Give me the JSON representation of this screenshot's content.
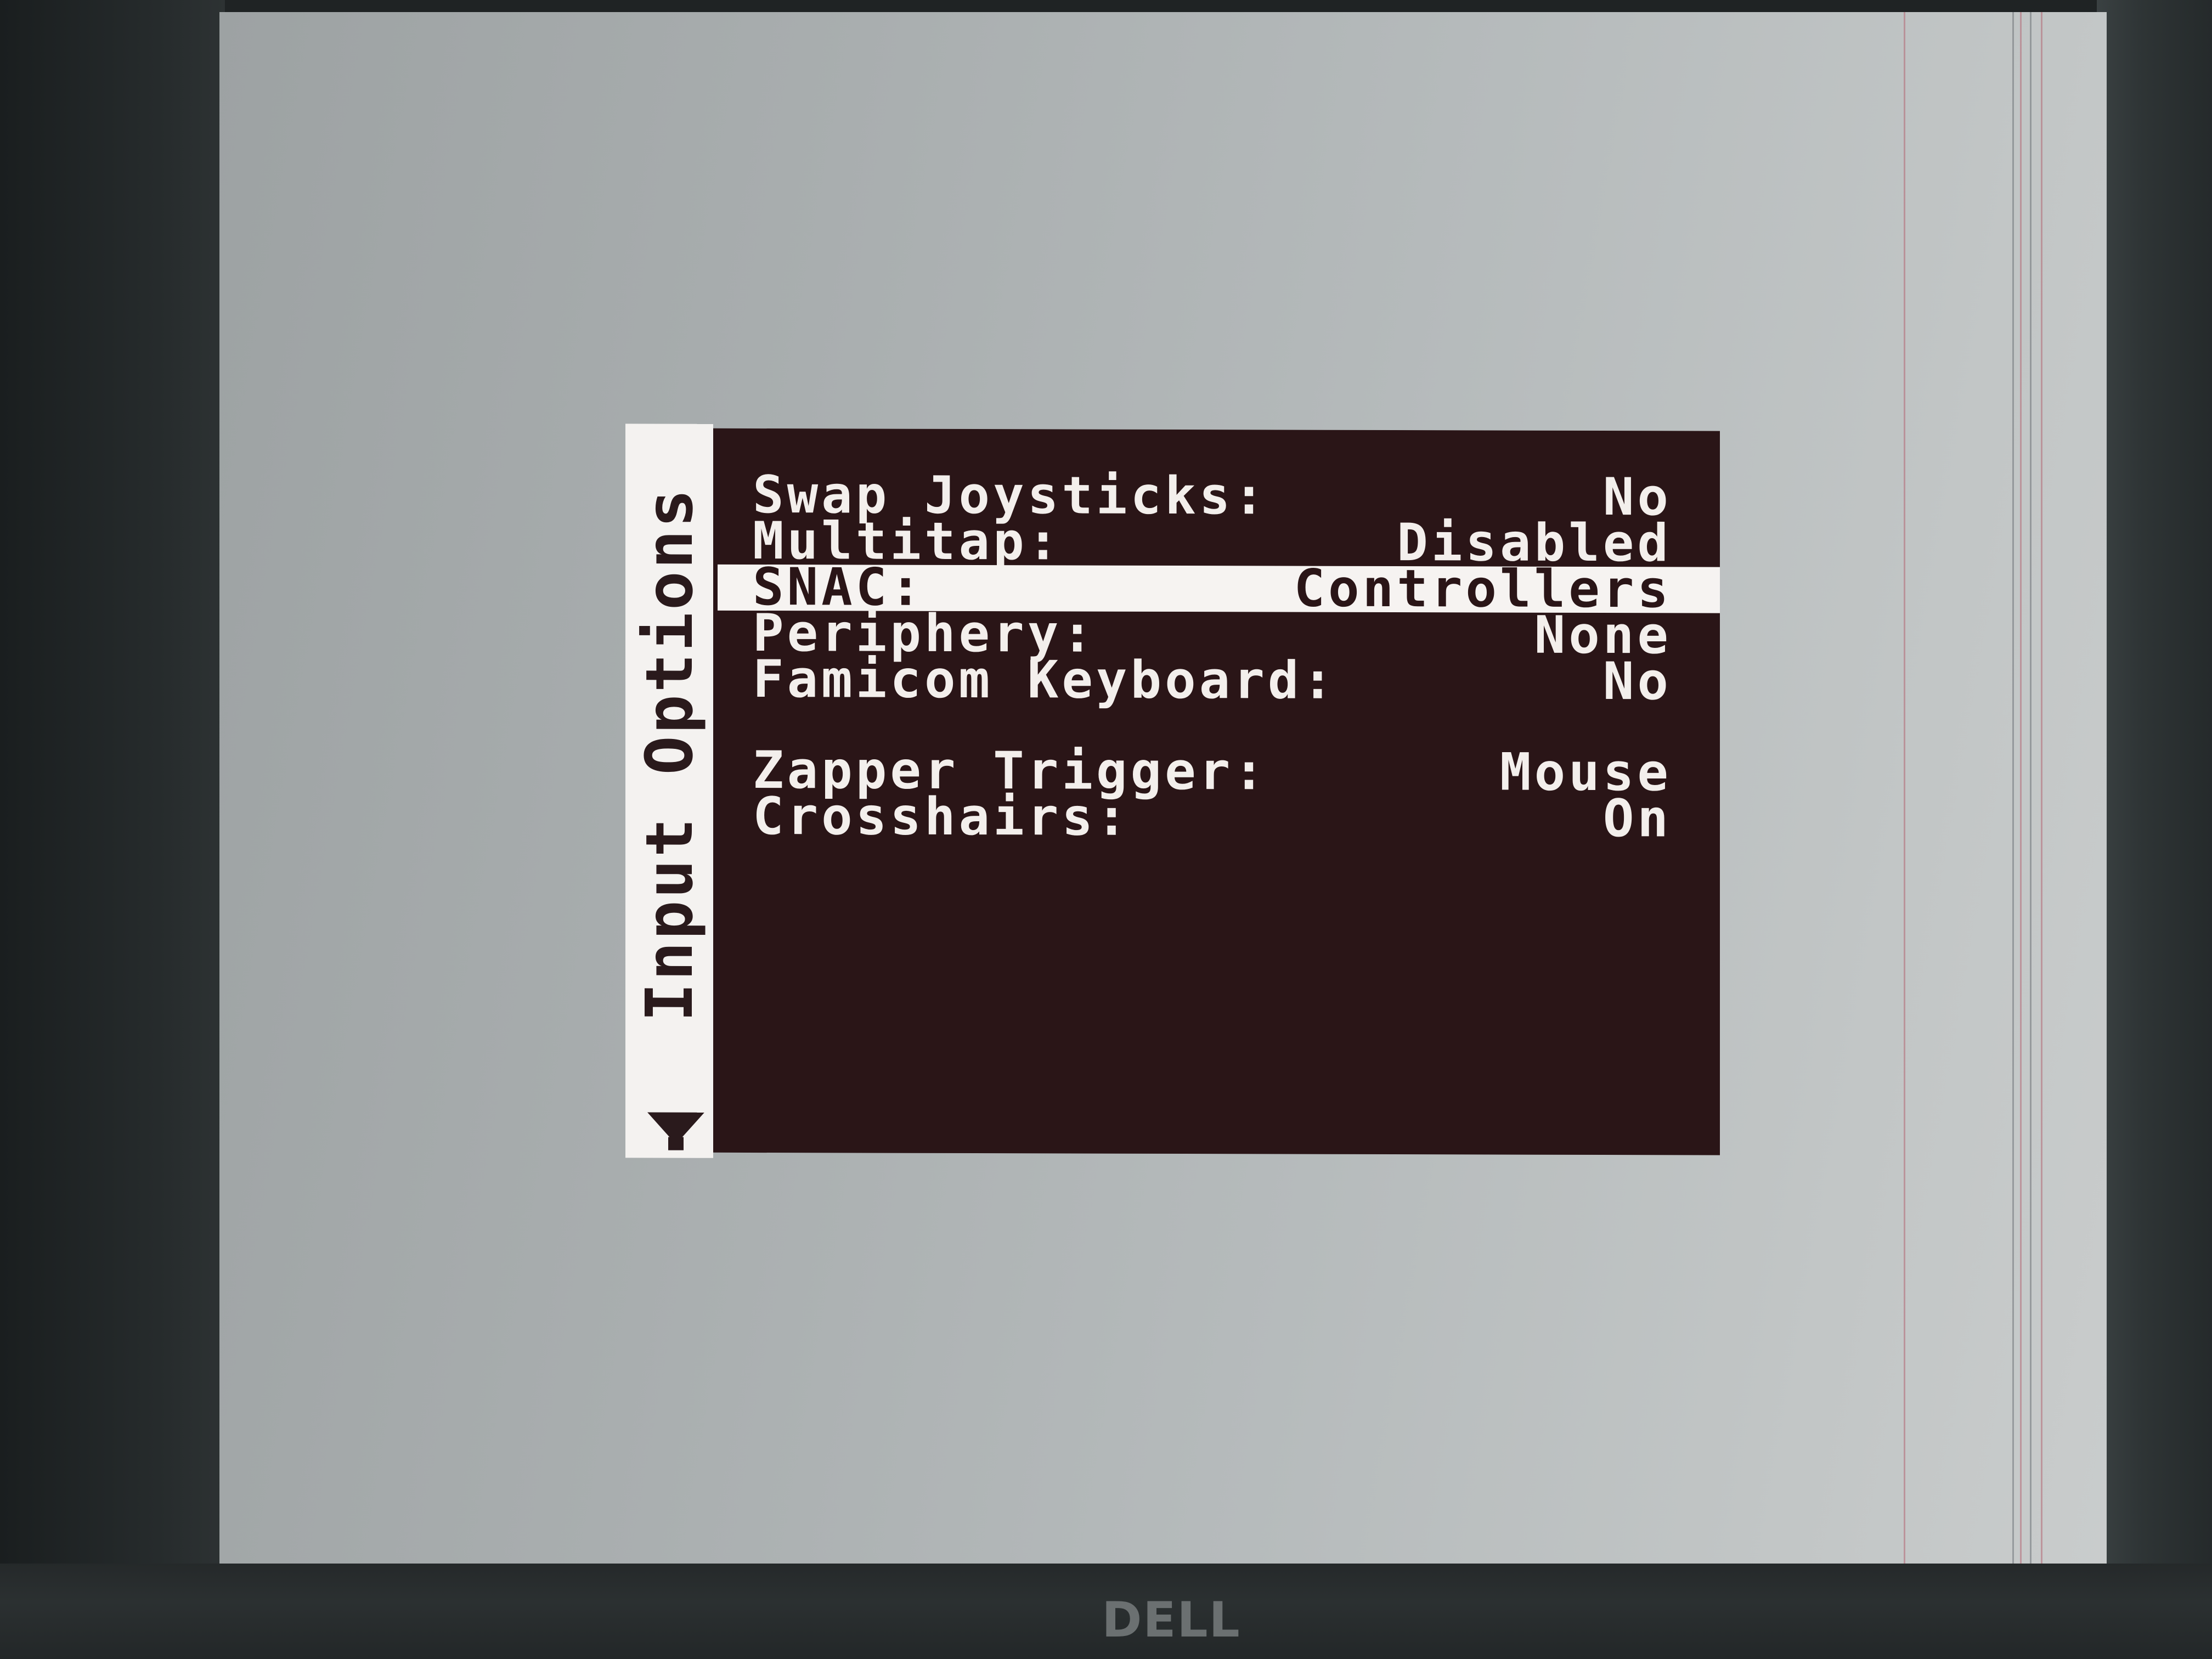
{
  "monitor": {
    "brand": "DELL"
  },
  "menu": {
    "title": "Input Options",
    "scroll_indicator": "down-arrow-icon",
    "items": [
      {
        "label": "Swap Joysticks:",
        "value": "No",
        "selected": false
      },
      {
        "label": "Multitap:",
        "value": "Disabled",
        "selected": false
      },
      {
        "label": "SNAC:",
        "value": "Controllers",
        "selected": true
      },
      {
        "label": "Periphery:",
        "value": "None",
        "selected": false
      },
      {
        "label": "Famicom Keyboard:",
        "value": "No",
        "selected": false
      },
      {
        "label": "Zapper Trigger:",
        "value": "Mouse",
        "selected": false
      },
      {
        "label": "Crosshairs:",
        "value": "On",
        "selected": false
      }
    ]
  },
  "colors": {
    "panel_background": "#2a1517",
    "panel_text": "#f3efec",
    "highlight_background": "#f6f3f1",
    "screen_background": "#b0b5b6"
  }
}
